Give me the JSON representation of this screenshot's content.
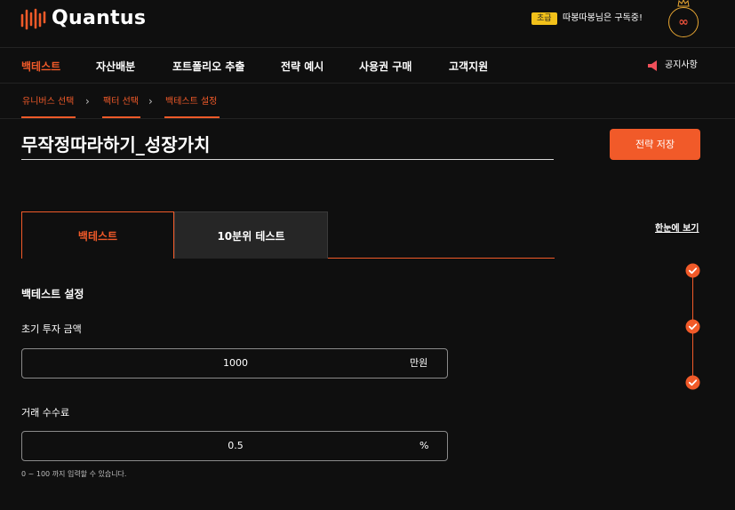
{
  "brand": {
    "name": "Quantus",
    "accent": "#f15a29"
  },
  "header": {
    "grade_badge": "초급",
    "user_status": "따봉따봉님은 구독중!",
    "avatar_glyph": "∞"
  },
  "nav": {
    "items": [
      "백테스트",
      "자산배분",
      "포트폴리오 추출",
      "전략 예시",
      "사용권 구매",
      "고객지원"
    ],
    "active_index": 0,
    "notice": "공지사항"
  },
  "breadcrumb": [
    "유니버스 선택",
    "팩터 선택",
    "백테스트 설정"
  ],
  "strategy": {
    "title": "무작정따라하기_성장가치",
    "save_label": "전략 저장"
  },
  "tabs": [
    {
      "label": "백테스트",
      "active": true
    },
    {
      "label": "10분위 테스트",
      "active": false
    }
  ],
  "sidebar": {
    "overview_link": "한눈에 보기",
    "steps_completed": 3
  },
  "form": {
    "section_title": "백테스트 설정",
    "initial_investment": {
      "label": "초기 투자 금액",
      "value": "1000",
      "unit": "만원"
    },
    "commission": {
      "label": "거래 수수료",
      "value": "0.5",
      "unit": "%",
      "hint": "0 ~ 100 까지 입력할 수 있습니다."
    }
  }
}
